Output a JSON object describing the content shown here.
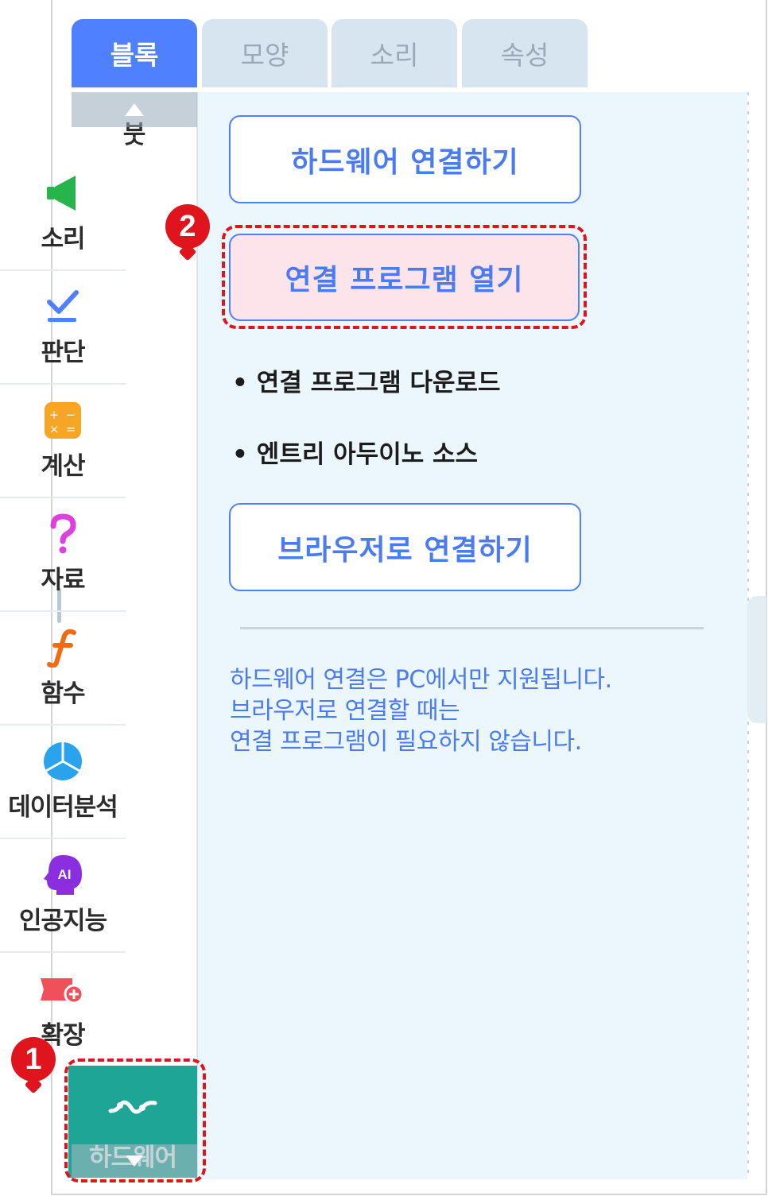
{
  "tabs": [
    {
      "label": "블록",
      "active": true
    },
    {
      "label": "모양",
      "active": false
    },
    {
      "label": "소리",
      "active": false
    },
    {
      "label": "속성",
      "active": false
    }
  ],
  "sidebar": {
    "items": [
      {
        "label": "붓",
        "icon": "brush-icon"
      },
      {
        "label": "소리",
        "icon": "speaker-icon"
      },
      {
        "label": "판단",
        "icon": "check-icon"
      },
      {
        "label": "계산",
        "icon": "calculator-icon"
      },
      {
        "label": "자료",
        "icon": "question-icon"
      },
      {
        "label": "함수",
        "icon": "function-icon"
      },
      {
        "label": "데이터분석",
        "icon": "pie-chart-icon"
      },
      {
        "label": "인공지능",
        "icon": "ai-head-icon"
      },
      {
        "label": "확장",
        "icon": "extension-icon"
      }
    ],
    "selected": {
      "label": "하드웨어",
      "icon": "hardware-link-icon"
    }
  },
  "panel": {
    "connect_hardware": "하드웨어 연결하기",
    "open_program": "연결 프로그램 열기",
    "download_link": "연결 프로그램 다운로드",
    "source_link": "엔트리 아두이노 소스",
    "bullet": "•",
    "browser_connect": "브라우저로 연결하기",
    "notes": [
      "하드웨어 연결은 PC에서만 지원됩니다.",
      "브라우저로 연결할 때는",
      "연결 프로그램이 필요하지 않습니다."
    ]
  },
  "markers": [
    "1",
    "2"
  ],
  "colors": {
    "accent": "#4f80ff",
    "hardware": "#1fa596",
    "highlight": "#e0141c",
    "pink": "#fde3ea",
    "panel": "#ecf6fd"
  }
}
